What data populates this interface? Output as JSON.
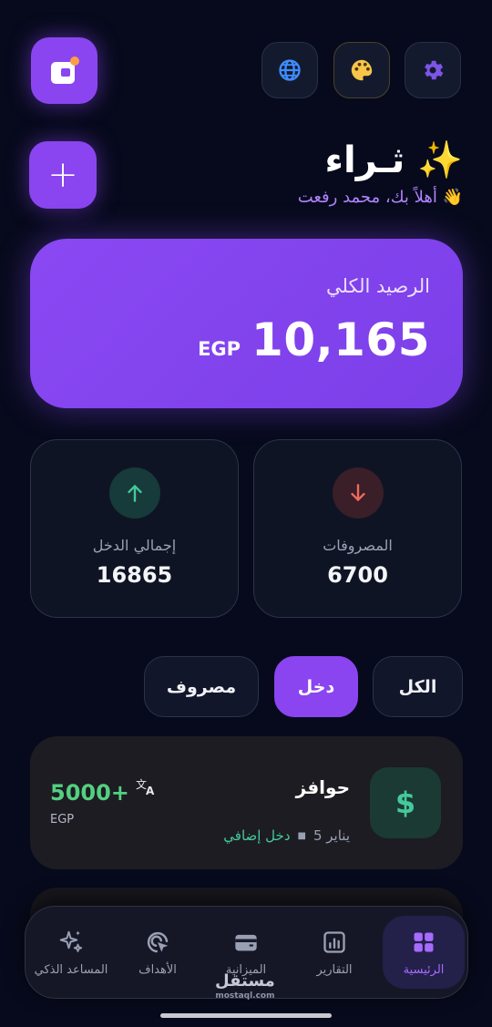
{
  "header": {
    "brand": "ثـراء ✨",
    "greeting": "أهلاً بك، محمد رفعت 👋"
  },
  "top_buttons": {
    "language_icon": "globe-icon",
    "theme_icon": "palette-icon",
    "settings_icon": "gear-icon",
    "add_label": "+"
  },
  "balance": {
    "label": "الرصيد الكلي",
    "amount": "10,165",
    "currency": "EGP"
  },
  "stats": {
    "expenses": {
      "label": "المصروفات",
      "value": "6700"
    },
    "income": {
      "label": "إجمالي الدخل",
      "value": "16865"
    }
  },
  "filters": {
    "all": "الكل",
    "income": "دخل",
    "expense": "مصروف",
    "active": "income"
  },
  "transactions": [
    {
      "title": "حوافز",
      "type": "دخل إضافي",
      "date": "5 يناير",
      "amount": "5000+",
      "currency": "EGP"
    }
  ],
  "nav": {
    "home": "الرئيسية",
    "reports": "التقارير",
    "budget": "الميزانية",
    "goals": "الأهداف",
    "assistant": "المساعد الذكي"
  },
  "watermark": {
    "arabic": "مستقل",
    "latin": "mostaql.com"
  },
  "colors": {
    "accent": "#8a45f0",
    "income_green": "#53d081",
    "expense_red": "#ef6b5b",
    "background": "#070a1c"
  }
}
